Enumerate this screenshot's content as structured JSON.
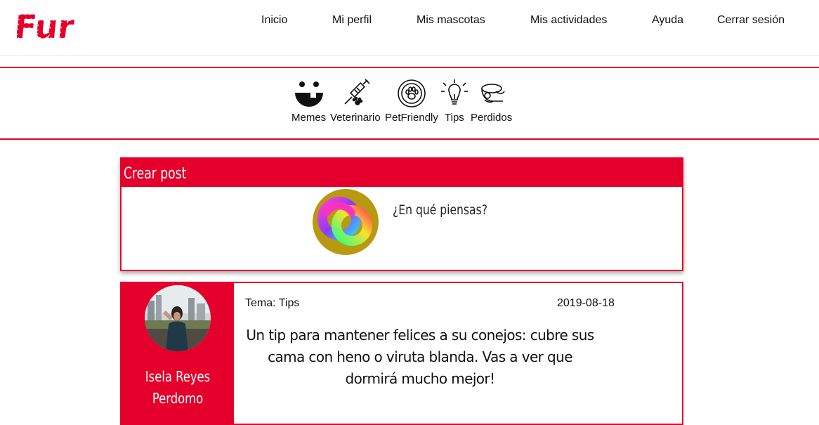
{
  "brand": {
    "logo_text": "Fur",
    "accent": "#e4002b"
  },
  "nav": [
    {
      "label": "Inicio"
    },
    {
      "label": "Mi perfil"
    },
    {
      "label": "Mis mascotas"
    },
    {
      "label": "Mis actividades"
    },
    {
      "label": "Ayuda"
    },
    {
      "label": "Cerrar sesión"
    }
  ],
  "categories": [
    {
      "label": "Memes",
      "icon": "smiley-icon"
    },
    {
      "label": "Veterinario",
      "icon": "syringe-icon"
    },
    {
      "label": "PetFriendly",
      "icon": "paw-circle-icon"
    },
    {
      "label": "Tips",
      "icon": "lightbulb-icon"
    },
    {
      "label": "Perdidos",
      "icon": "lost-pet-icon"
    }
  ],
  "create_post": {
    "title": "Crear post",
    "placeholder": "¿En qué piensas?"
  },
  "post": {
    "author": "Isela Reyes Perdomo",
    "topic": "Tema: Tips",
    "date": "2019-08-18",
    "text": "Un tip para mantener felices a su conejos: cubre sus cama con heno o viruta blanda. Vas a ver que dormirá mucho mejor!"
  }
}
